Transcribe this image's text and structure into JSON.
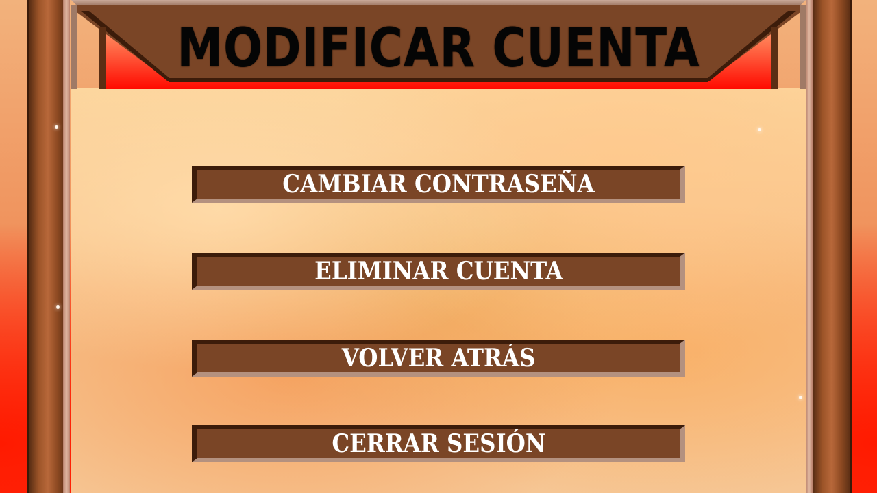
{
  "screen": {
    "title": "MODIFICAR CUENTA"
  },
  "menu": {
    "items": [
      {
        "label": "CAMBIAR CONTRASEÑA"
      },
      {
        "label": "ELIMINAR CUENTA"
      },
      {
        "label": "VOLVER ATRÁS"
      },
      {
        "label": "CERRAR SESIÓN"
      }
    ]
  },
  "colors": {
    "frame_wood": "#7a4526",
    "frame_dark": "#3c1c0a",
    "frame_light": "#b4917f",
    "button_text": "#ffffff",
    "title_text": "#050505",
    "background_red": "#ff1a00"
  }
}
